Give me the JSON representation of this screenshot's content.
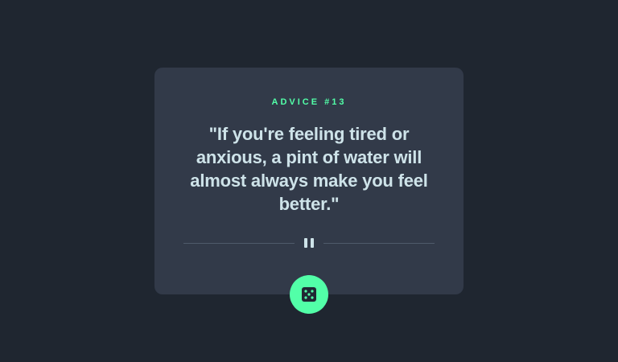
{
  "advice": {
    "id_label": "ADVICE #13",
    "text": "\"If you're feeling tired or anxious, a pint of water will almost always make you feel better.\""
  },
  "icons": {
    "divider": "pause-icon",
    "button": "dice-icon"
  },
  "colors": {
    "background": "#1f2630",
    "card": "#323a49",
    "accent": "#52ffa8",
    "text": "#cee3e9",
    "divider": "#4f5b6b"
  }
}
